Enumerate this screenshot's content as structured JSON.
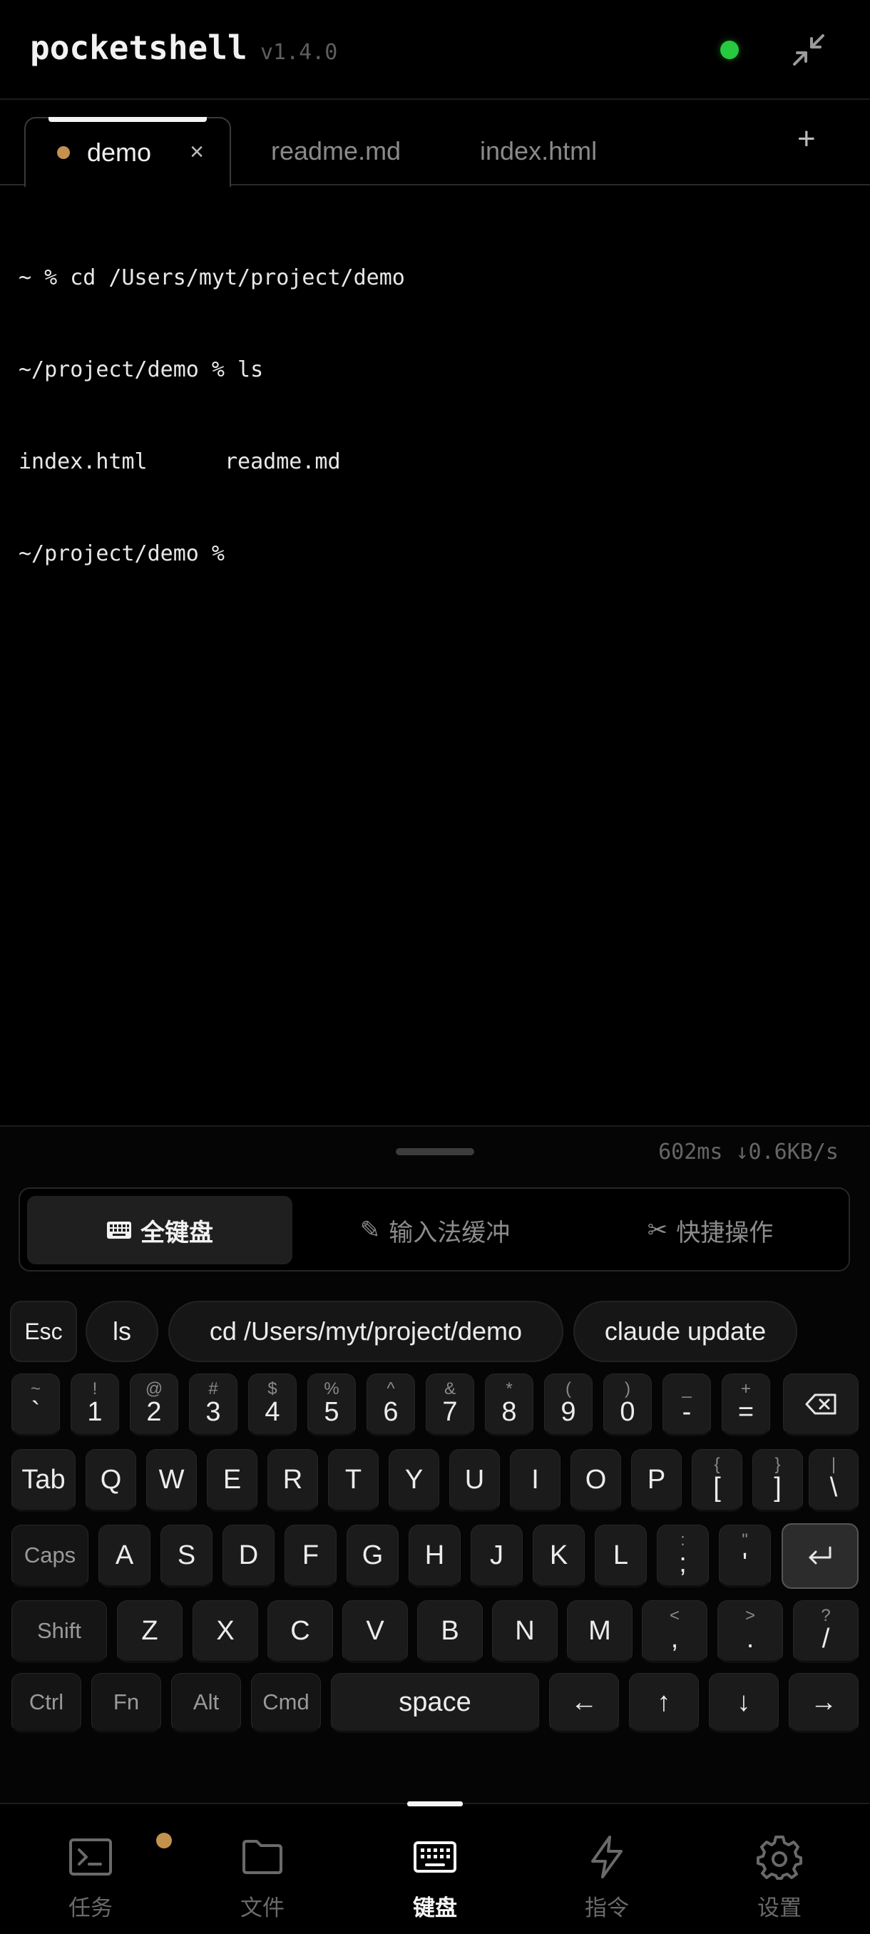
{
  "app": {
    "name": "pocketshell",
    "version": "v1.4.0",
    "status_color": "#27c93f"
  },
  "tabs": [
    {
      "label": "demo",
      "active": true,
      "close": "×"
    },
    {
      "label": "readme.md"
    },
    {
      "label": "index.html"
    }
  ],
  "add_tab": "+",
  "terminal": {
    "lines": [
      "~ % cd /Users/myt/project/demo",
      "~/project/demo % ls",
      "index.html      readme.md",
      "~/project/demo %"
    ]
  },
  "netstat": "602ms ↓0.6KB/s",
  "modes": [
    {
      "label": "全键盘",
      "icon": "keyboard-icon"
    },
    {
      "label": "输入法缓冲",
      "icon": "pencil-icon"
    },
    {
      "label": "快捷操作",
      "icon": "scissors-icon"
    }
  ],
  "shortcuts": [
    "Esc",
    "ls",
    "cd /Users/myt/project/demo",
    "claude update"
  ],
  "keys": {
    "row1": [
      {
        "sub": "~",
        "main": "`"
      },
      {
        "sub": "!",
        "main": "1"
      },
      {
        "sub": "@",
        "main": "2"
      },
      {
        "sub": "#",
        "main": "3"
      },
      {
        "sub": "$",
        "main": "4"
      },
      {
        "sub": "%",
        "main": "5"
      },
      {
        "sub": "^",
        "main": "6"
      },
      {
        "sub": "&",
        "main": "7"
      },
      {
        "sub": "*",
        "main": "8"
      },
      {
        "sub": "(",
        "main": "9"
      },
      {
        "sub": ")",
        "main": "0"
      },
      {
        "sub": "_",
        "main": "-"
      },
      {
        "sub": "+",
        "main": "="
      }
    ],
    "row2": [
      "Tab",
      "Q",
      "W",
      "E",
      "R",
      "T",
      "Y",
      "U",
      "I",
      "O",
      "P"
    ],
    "row2_sym": [
      {
        "sub": "{",
        "main": "["
      },
      {
        "sub": "}",
        "main": "]"
      },
      {
        "sub": "|",
        "main": "\\"
      }
    ],
    "row3": [
      "Caps",
      "A",
      "S",
      "D",
      "F",
      "G",
      "H",
      "J",
      "K",
      "L"
    ],
    "row3_sym": [
      {
        "sub": ":",
        "main": ";"
      },
      {
        "sub": "\"",
        "main": "'"
      }
    ],
    "row4": [
      "Shift",
      "Z",
      "X",
      "C",
      "V",
      "B",
      "N",
      "M"
    ],
    "row4_sym": [
      {
        "sub": "<",
        "main": ","
      },
      {
        "sub": ">",
        "main": "."
      },
      {
        "sub": "?",
        "main": "/"
      }
    ],
    "row5_mods": [
      "Ctrl",
      "Fn",
      "Alt",
      "Cmd"
    ],
    "space": "space",
    "arrows": [
      "←",
      "↑",
      "↓",
      "→"
    ]
  },
  "nav": [
    {
      "label": "任务",
      "icon": "terminal-icon",
      "badge_color": "#c4924f"
    },
    {
      "label": "文件",
      "icon": "folder-icon"
    },
    {
      "label": "键盘",
      "icon": "keyboard-icon",
      "active": true
    },
    {
      "label": "指令",
      "icon": "lightning-icon"
    },
    {
      "label": "设置",
      "icon": "gear-icon"
    }
  ]
}
